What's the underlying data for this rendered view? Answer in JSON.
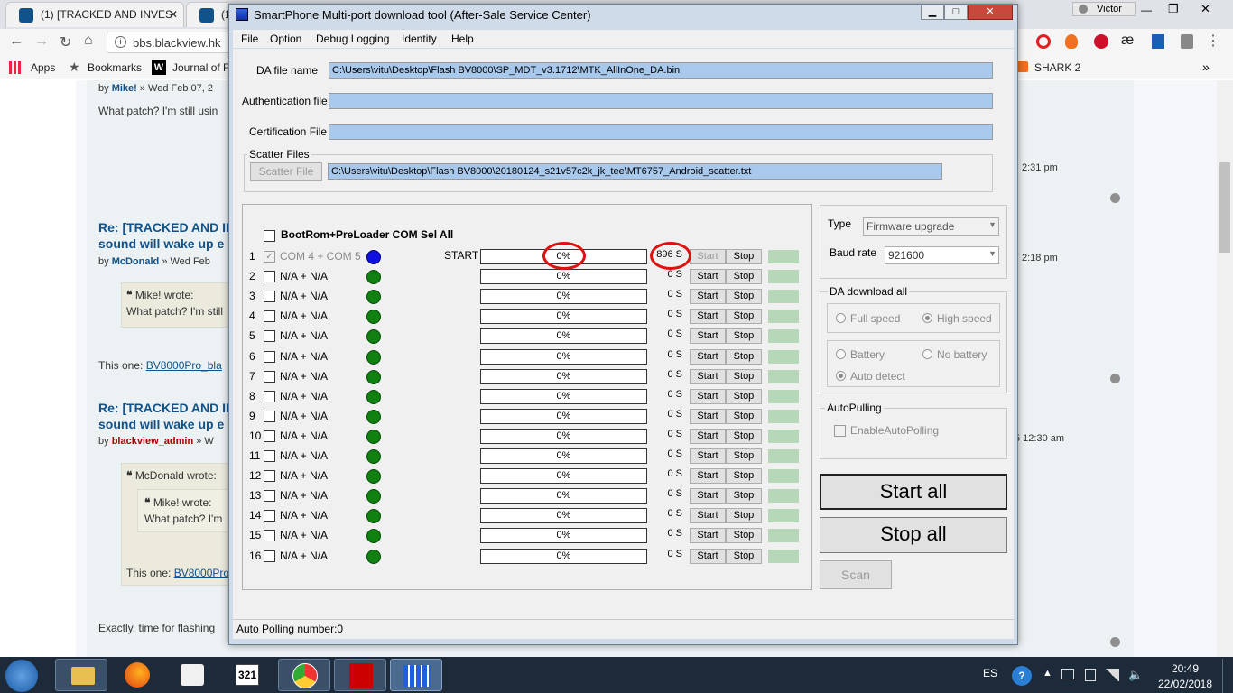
{
  "browser": {
    "tab1_label": "(1) [TRACKED AND INVES",
    "tab1_close": "✕",
    "tab2_label": "(1",
    "profile": "Victor",
    "url": "bbs.blackview.hk",
    "bookmarks": {
      "apps": "Apps",
      "bookmarks": "Bookmarks",
      "journal": "Journal of F",
      "shark": "SHARK 2"
    }
  },
  "webpage": {
    "post1_by": "by",
    "post1_author": "Mike!",
    "post1_date": "» Wed Feb 07, 2",
    "post1_text": "What patch? I'm still usin",
    "time1": "2:31 pm",
    "post2_title_a": "Re: [TRACKED AND II",
    "post2_title_b": "sound will wake up e",
    "post2_author": "McDonald",
    "post2_date": "» Wed Feb",
    "time2": "2:18 pm",
    "quote1_author": "Mike! wrote:",
    "quote1_text": "What patch? I'm still",
    "this_one_label": "This one:",
    "this_one_link": "BV8000Pro_bla",
    "post3_title_a": "Re: [TRACKED AND II",
    "post3_title_b": "sound will wake up e",
    "post3_author": "blackview_admin",
    "post3_date": "» W",
    "time3": "5 12:30 am",
    "quote2_author": "McDonald wrote:",
    "quote2_inner_author": "Mike! wrote:",
    "quote2_inner_text": "What patch? I'm",
    "quote2_this_one": "This one:",
    "quote2_link": "BV8000Pro",
    "bottom_text": "Exactly, time for flashing"
  },
  "app": {
    "title": "SmartPhone Multi-port download tool (After-Sale Service Center)",
    "menu": [
      "File",
      "Option",
      "Debug Logging",
      "Identity",
      "Help"
    ],
    "da_label": "DA file name",
    "da_path": "C:\\Users\\vitu\\Desktop\\Flash BV8000\\SP_MDT_v3.1712\\MTK_AllInOne_DA.bin",
    "auth_label": "Authentication file",
    "auth_path": "",
    "cert_label": "Certification File",
    "cert_path": "",
    "scatter_group": "Scatter Files",
    "scatter_button": "Scatter File",
    "scatter_path": "C:\\Users\\vitu\\Desktop\\Flash BV8000\\20180124_s21v57c2k_jk_tee\\MT6757_Android_scatter.txt",
    "bootrom_label": "BootRom+PreLoader COM Sel All",
    "rows": [
      {
        "num": "1",
        "com": "COM 4 + COM 5",
        "state": "START",
        "progress": "0%",
        "time": "896 S",
        "start": "Start",
        "stop": "Stop"
      },
      {
        "num": "2",
        "com": "N/A + N/A",
        "state": "",
        "progress": "0%",
        "time": "0 S",
        "start": "Start",
        "stop": "Stop"
      },
      {
        "num": "3",
        "com": "N/A + N/A",
        "state": "",
        "progress": "0%",
        "time": "0 S",
        "start": "Start",
        "stop": "Stop"
      },
      {
        "num": "4",
        "com": "N/A + N/A",
        "state": "",
        "progress": "0%",
        "time": "0 S",
        "start": "Start",
        "stop": "Stop"
      },
      {
        "num": "5",
        "com": "N/A + N/A",
        "state": "",
        "progress": "0%",
        "time": "0 S",
        "start": "Start",
        "stop": "Stop"
      },
      {
        "num": "6",
        "com": "N/A + N/A",
        "state": "",
        "progress": "0%",
        "time": "0 S",
        "start": "Start",
        "stop": "Stop"
      },
      {
        "num": "7",
        "com": "N/A + N/A",
        "state": "",
        "progress": "0%",
        "time": "0 S",
        "start": "Start",
        "stop": "Stop"
      },
      {
        "num": "8",
        "com": "N/A + N/A",
        "state": "",
        "progress": "0%",
        "time": "0 S",
        "start": "Start",
        "stop": "Stop"
      },
      {
        "num": "9",
        "com": "N/A + N/A",
        "state": "",
        "progress": "0%",
        "time": "0 S",
        "start": "Start",
        "stop": "Stop"
      },
      {
        "num": "10",
        "com": "N/A + N/A",
        "state": "",
        "progress": "0%",
        "time": "0 S",
        "start": "Start",
        "stop": "Stop"
      },
      {
        "num": "11",
        "com": "N/A + N/A",
        "state": "",
        "progress": "0%",
        "time": "0 S",
        "start": "Start",
        "stop": "Stop"
      },
      {
        "num": "12",
        "com": "N/A + N/A",
        "state": "",
        "progress": "0%",
        "time": "0 S",
        "start": "Start",
        "stop": "Stop"
      },
      {
        "num": "13",
        "com": "N/A + N/A",
        "state": "",
        "progress": "0%",
        "time": "0 S",
        "start": "Start",
        "stop": "Stop"
      },
      {
        "num": "14",
        "com": "N/A + N/A",
        "state": "",
        "progress": "0%",
        "time": "0 S",
        "start": "Start",
        "stop": "Stop"
      },
      {
        "num": "15",
        "com": "N/A + N/A",
        "state": "",
        "progress": "0%",
        "time": "0 S",
        "start": "Start",
        "stop": "Stop"
      },
      {
        "num": "16",
        "com": "N/A + N/A",
        "state": "",
        "progress": "0%",
        "time": "0 S",
        "start": "Start",
        "stop": "Stop"
      }
    ],
    "type_label": "Type",
    "type_value": "Firmware upgrade",
    "baud_label": "Baud rate",
    "baud_value": "921600",
    "da_download_group": "DA download all",
    "full_speed": "Full speed",
    "high_speed": "High speed",
    "battery": "Battery",
    "no_battery": "No battery",
    "auto_detect": "Auto detect",
    "autopolling_group": "AutoPulling",
    "enable_autopolling": "EnableAutoPolling",
    "start_all": "Start all",
    "stop_all": "Stop all",
    "scan": "Scan",
    "status": "Auto Polling number:0"
  },
  "taskbar": {
    "lang": "ES",
    "time": "20:49",
    "date": "22/02/2018"
  },
  "colors": {
    "path_fill": "#a8c8ec",
    "port_connected": "#1010e0",
    "port_idle": "#108010",
    "highlight_ring": "#e01010"
  }
}
